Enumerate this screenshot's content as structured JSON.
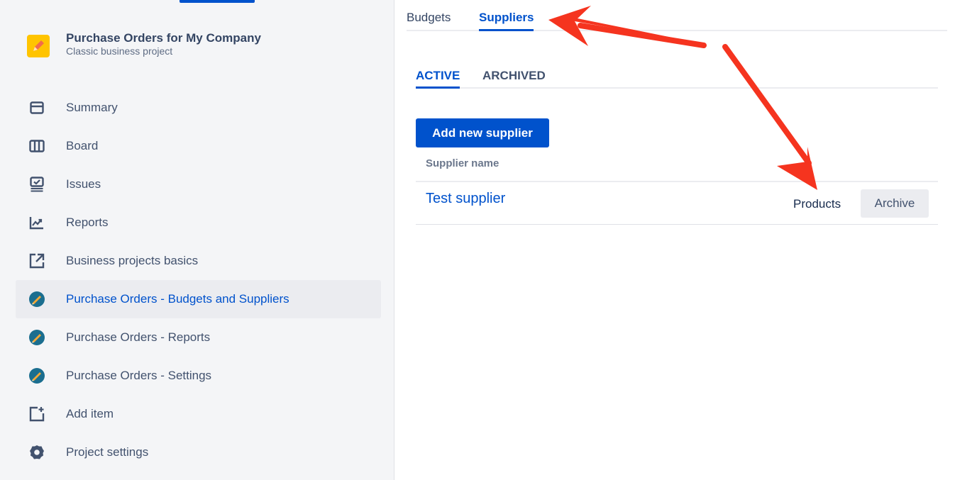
{
  "sidebar": {
    "project_name": "Purchase Orders for My Company",
    "project_type": "Classic business project",
    "items": [
      {
        "label": "Summary",
        "icon": "summary-icon"
      },
      {
        "label": "Board",
        "icon": "board-icon"
      },
      {
        "label": "Issues",
        "icon": "issues-icon"
      },
      {
        "label": "Reports",
        "icon": "reports-icon"
      },
      {
        "label": "Business projects basics",
        "icon": "external-link-icon"
      },
      {
        "label": "Purchase Orders - Budgets and Suppliers",
        "icon": "app-icon",
        "selected": true
      },
      {
        "label": "Purchase Orders - Reports",
        "icon": "app-icon"
      },
      {
        "label": "Purchase Orders - Settings",
        "icon": "app-icon"
      },
      {
        "label": "Add item",
        "icon": "add-item-icon"
      },
      {
        "label": "Project settings",
        "icon": "gear-icon"
      }
    ]
  },
  "top_tabs": [
    {
      "label": "Budgets",
      "active": false
    },
    {
      "label": "Suppliers",
      "active": true
    }
  ],
  "sub_tabs": [
    {
      "label": "ACTIVE",
      "active": true
    },
    {
      "label": "ARCHIVED",
      "active": false
    }
  ],
  "add_supplier_label": "Add new supplier",
  "table": {
    "column_header": "Supplier name",
    "rows": [
      {
        "name": "Test supplier",
        "products_label": "Products",
        "archive_label": "Archive"
      }
    ]
  },
  "colors": {
    "accent": "#0052cc",
    "annotation_arrow": "#f5341f",
    "sidebar_bg": "#f4f5f7"
  }
}
